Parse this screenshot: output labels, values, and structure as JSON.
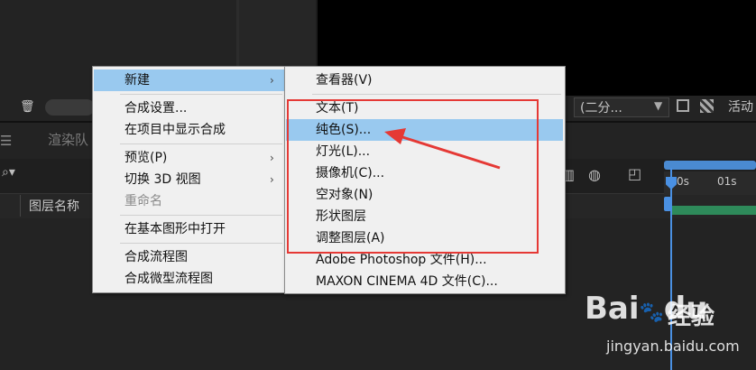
{
  "background": {
    "tab_menu_icon": "menu-icon",
    "tab_render_label": "渲染队",
    "column_layer_name": "图层名称",
    "resolution_dropdown": "(二分...",
    "active_label": "活动",
    "ruler_ticks": [
      "0s",
      "01s"
    ]
  },
  "menu_primary": {
    "items": [
      {
        "label": "新建",
        "has_submenu": true,
        "highlighted": true
      },
      {
        "label": "合成设置..."
      },
      {
        "label": "在项目中显示合成"
      },
      {
        "label": "预览(P)",
        "has_submenu": true
      },
      {
        "label": "切换 3D 视图",
        "has_submenu": true
      },
      {
        "label": "重命名",
        "disabled": true
      },
      {
        "label": "在基本图形中打开"
      },
      {
        "label": "合成流程图"
      },
      {
        "label": "合成微型流程图"
      }
    ]
  },
  "menu_new": {
    "items": [
      {
        "label": "查看器(V)"
      },
      {
        "label": "文本(T)"
      },
      {
        "label": "纯色(S)...",
        "highlighted": true
      },
      {
        "label": "灯光(L)..."
      },
      {
        "label": "摄像机(C)..."
      },
      {
        "label": "空对象(N)"
      },
      {
        "label": "形状图层"
      },
      {
        "label": "调整图层(A)"
      },
      {
        "label": "Adobe Photoshop 文件(H)..."
      },
      {
        "label": "MAXON CINEMA 4D 文件(C)..."
      }
    ]
  },
  "annotation": {
    "color": "#e53935"
  },
  "watermark": {
    "logo_text": "Bai",
    "logo_suffix": "du",
    "cn_text": "经验",
    "url": "jingyan.baidu.com"
  }
}
